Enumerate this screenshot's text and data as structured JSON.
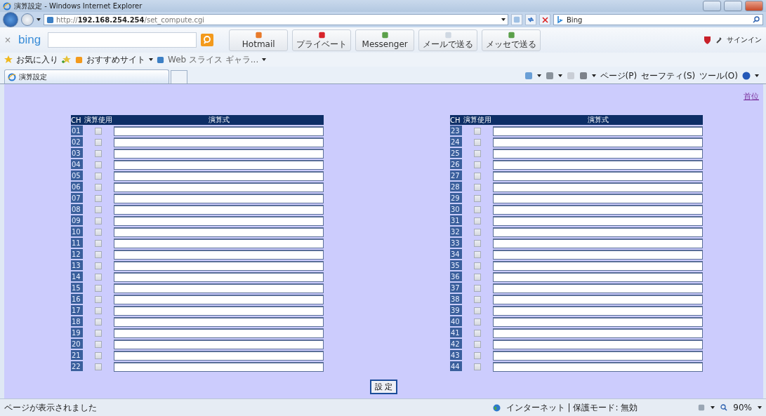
{
  "window": {
    "title": "演算設定 - Windows Internet Explorer"
  },
  "address_bar": {
    "url": "http://**192.168.254.254**/set_compute.cgi",
    "search_value": "Bing"
  },
  "bing_toolbar": {
    "close": "×",
    "logo": "bing",
    "buttons": [
      "Hotmail",
      "プライベート",
      "Messenger",
      "メールで送る",
      "メッセで送る"
    ],
    "signin": "サインイン"
  },
  "favorites_bar": {
    "favorites": "お気に入り",
    "links": [
      "おすすめサイト",
      "Web スライス ギャラ..."
    ]
  },
  "tabs": [
    {
      "label": "演算設定",
      "selected": true
    }
  ],
  "command_bar": [
    "ページ(P)",
    "セーフティ(S)",
    "ツール(O)"
  ],
  "page": {
    "top_link": "首位",
    "tables": [
      {
        "columns": [
          "CH",
          "演算使用",
          "演算式"
        ],
        "rows": [
          {
            "ch": "01",
            "checked": false
          },
          {
            "ch": "02",
            "checked": false
          },
          {
            "ch": "03",
            "checked": false
          },
          {
            "ch": "04",
            "checked": false
          },
          {
            "ch": "05",
            "checked": false
          },
          {
            "ch": "06",
            "checked": false
          },
          {
            "ch": "07",
            "checked": false
          },
          {
            "ch": "08",
            "checked": false
          },
          {
            "ch": "09",
            "checked": false
          },
          {
            "ch": "10",
            "checked": false
          },
          {
            "ch": "11",
            "checked": false
          },
          {
            "ch": "12",
            "checked": false
          },
          {
            "ch": "13",
            "checked": false
          },
          {
            "ch": "14",
            "checked": false
          },
          {
            "ch": "15",
            "checked": false
          },
          {
            "ch": "16",
            "checked": false
          },
          {
            "ch": "17",
            "checked": false
          },
          {
            "ch": "18",
            "checked": false
          },
          {
            "ch": "19",
            "checked": false
          },
          {
            "ch": "20",
            "checked": false
          },
          {
            "ch": "21",
            "checked": false
          },
          {
            "ch": "22",
            "checked": false
          }
        ]
      },
      {
        "columns": [
          "CH",
          "演算使用",
          "演算式"
        ],
        "rows": [
          {
            "ch": "23",
            "checked": false
          },
          {
            "ch": "24",
            "checked": false
          },
          {
            "ch": "25",
            "checked": false
          },
          {
            "ch": "26",
            "checked": false
          },
          {
            "ch": "27",
            "checked": false
          },
          {
            "ch": "28",
            "checked": false
          },
          {
            "ch": "29",
            "checked": false
          },
          {
            "ch": "30",
            "checked": false
          },
          {
            "ch": "31",
            "checked": false
          },
          {
            "ch": "32",
            "checked": false
          },
          {
            "ch": "33",
            "checked": false
          },
          {
            "ch": "34",
            "checked": false
          },
          {
            "ch": "35",
            "checked": false
          },
          {
            "ch": "36",
            "checked": false
          },
          {
            "ch": "37",
            "checked": false
          },
          {
            "ch": "38",
            "checked": false
          },
          {
            "ch": "39",
            "checked": false
          },
          {
            "ch": "40",
            "checked": false
          },
          {
            "ch": "41",
            "checked": false
          },
          {
            "ch": "42",
            "checked": false
          },
          {
            "ch": "43",
            "checked": false
          },
          {
            "ch": "44",
            "checked": false
          }
        ]
      }
    ],
    "submit": "設 定"
  },
  "status_bar": {
    "message": "ページが表示されました",
    "zone": "インターネット | 保護モード: 無効",
    "zoom": "90%"
  }
}
